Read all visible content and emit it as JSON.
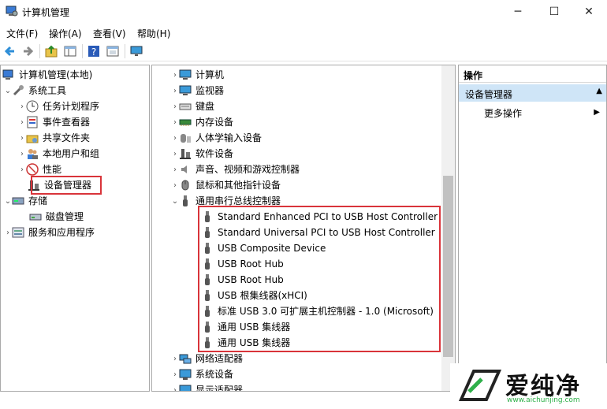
{
  "window": {
    "title": "计算机管理",
    "minimize_glyph": "─",
    "maximize_glyph": "☐",
    "close_glyph": "✕"
  },
  "menu": [
    "文件(F)",
    "操作(A)",
    "查看(V)",
    "帮助(H)"
  ],
  "left_tree": {
    "root": "计算机管理(本地)",
    "system_tools": "系统工具",
    "items": [
      "任务计划程序",
      "事件查看器",
      "共享文件夹",
      "本地用户和组",
      "性能",
      "设备管理器"
    ],
    "storage": "存储",
    "disk": "磁盘管理",
    "services": "服务和应用程序"
  },
  "device_tree": {
    "categories_top": [
      "计算机",
      "监视器",
      "键盘",
      "内存设备",
      "人体学输入设备",
      "软件设备",
      "声音、视频和游戏控制器",
      "鼠标和其他指针设备"
    ],
    "usb_category": "通用串行总线控制器",
    "usb_devices": [
      "Standard Enhanced PCI to USB Host Controller",
      "Standard Universal PCI to USB Host Controller",
      "USB Composite Device",
      "USB Root Hub",
      "USB Root Hub",
      "USB 根集线器(xHCI)",
      "标准 USB 3.0 可扩展主机控制器 - 1.0 (Microsoft)",
      "通用 USB 集线器",
      "通用 USB 集线器"
    ],
    "categories_bottom": [
      "网络适配器",
      "系统设备",
      "显示适配器"
    ]
  },
  "actions": {
    "header": "操作",
    "section": "设备管理器",
    "more": "更多操作"
  },
  "watermark": {
    "brand": "爱纯净",
    "url": "www.aichunjing.com"
  },
  "colors": {
    "highlight_border": "#d9343a",
    "selection_bg": "#cfe5f7"
  }
}
